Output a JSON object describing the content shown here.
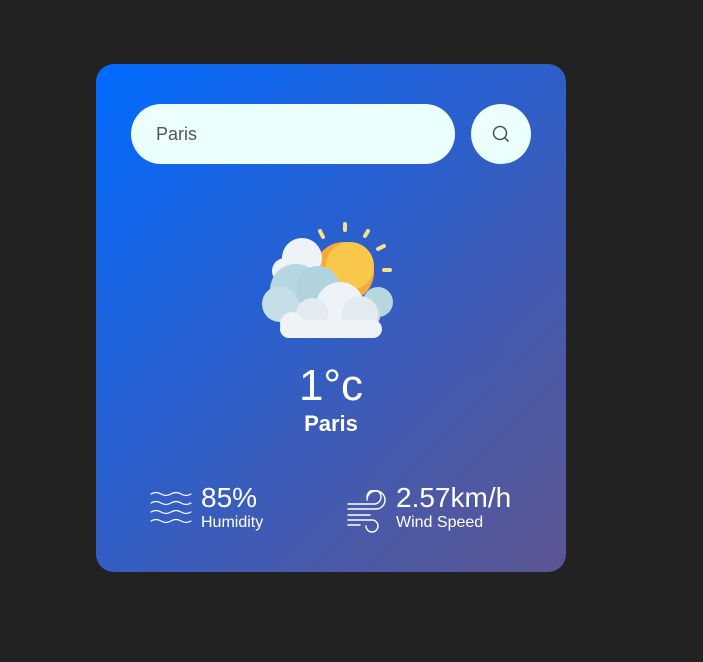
{
  "search": {
    "value": "Paris",
    "button_icon": "search-icon"
  },
  "weather": {
    "icon": "partly-cloudy-icon",
    "temperature": "1°c",
    "city": "Paris"
  },
  "details": {
    "humidity": {
      "value": "85%",
      "label": "Humidity",
      "icon": "humidity-icon"
    },
    "wind": {
      "value": "2.57km/h",
      "label": "Wind Speed",
      "icon": "wind-icon"
    }
  },
  "colors": {
    "background": "#222222",
    "card_gradient_start": "#006bff",
    "card_gradient_end": "#5b5691",
    "input_bg": "#ebfffc",
    "sun": "#f9b233",
    "cloud": "#eef3f7"
  }
}
